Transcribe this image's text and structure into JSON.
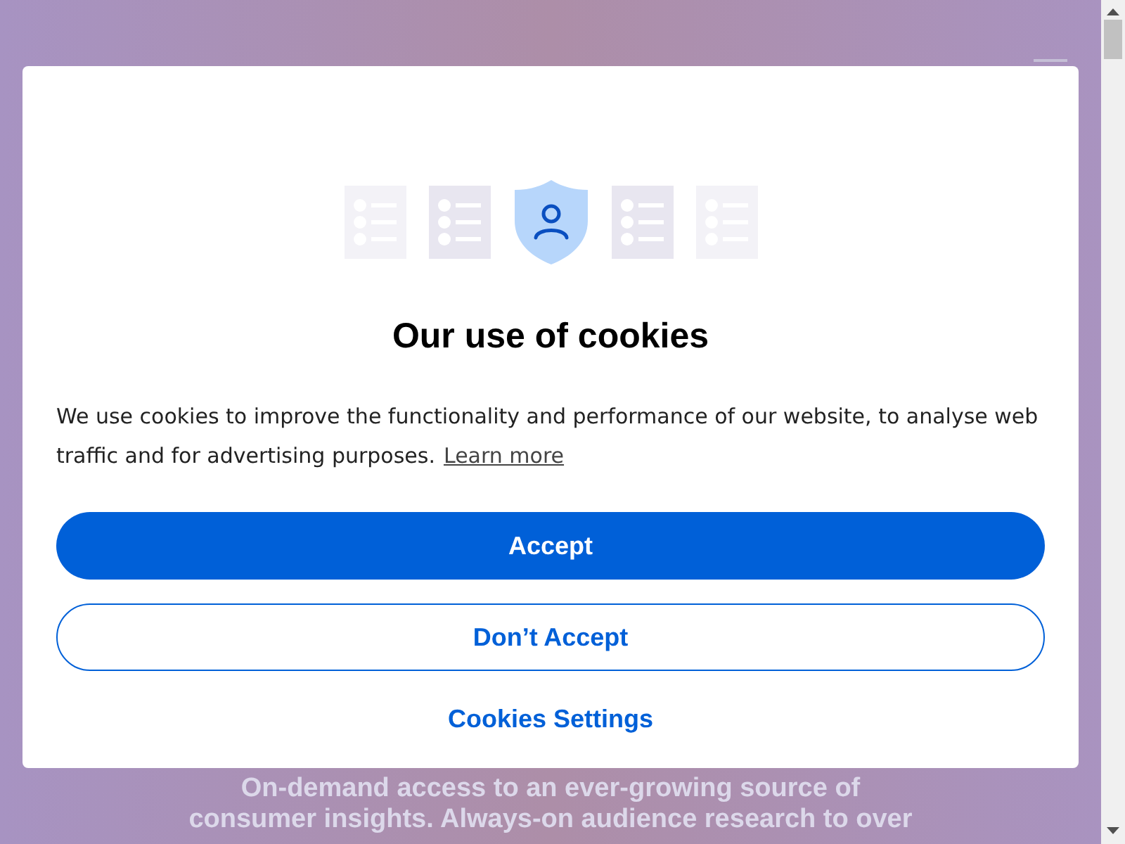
{
  "background": {
    "intro": [
      "On-demand access to an ever-growing source of",
      "consumer insights. Always-on audience research to over"
    ]
  },
  "dialog": {
    "title": "Our use of cookies",
    "message": "We use cookies to improve the functionality and performance of our website, to analyse web traffic and for advertising purposes.",
    "link": "Learn more",
    "buttons": [
      {
        "label": "Accept",
        "kind": "primary"
      },
      {
        "label": "Don’t Accept",
        "kind": "outline"
      },
      {
        "label": "Cookies Settings",
        "kind": "text"
      }
    ]
  }
}
